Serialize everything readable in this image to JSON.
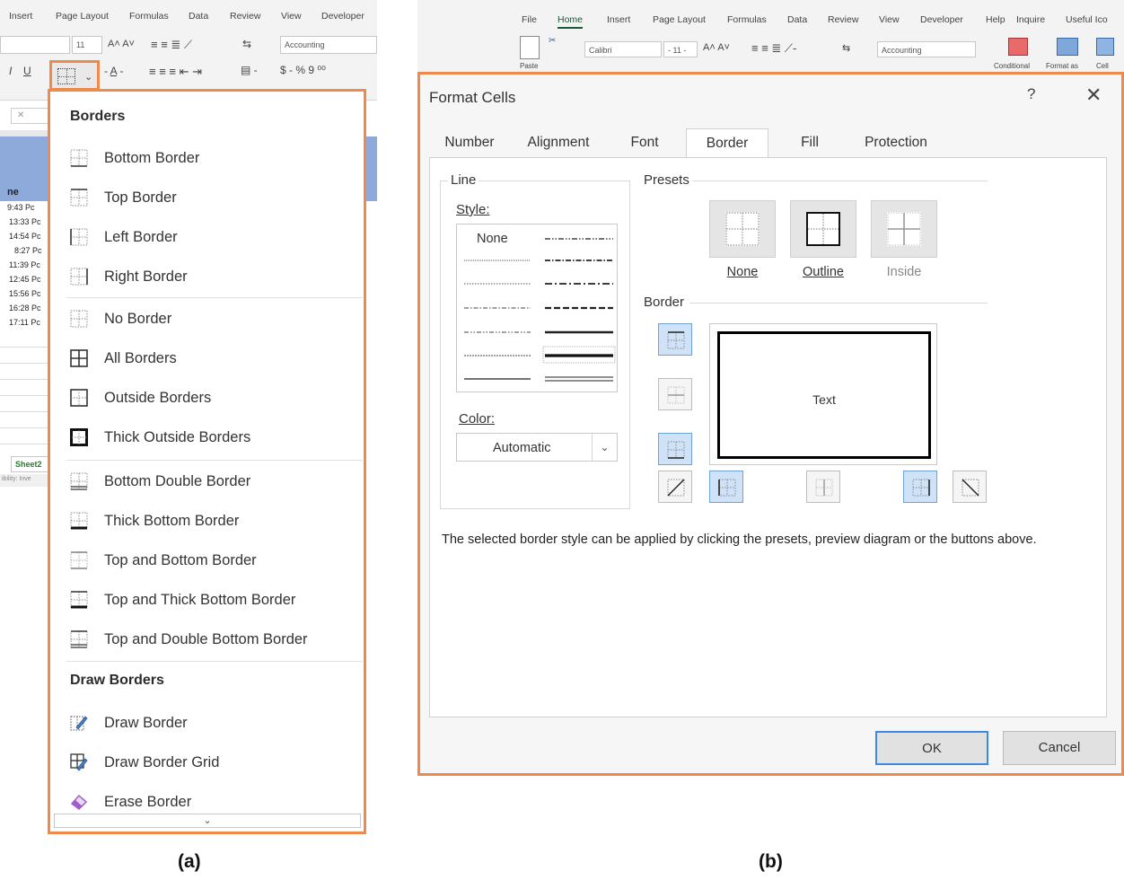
{
  "panel_a": {
    "ribbon": {
      "tabs": [
        "Insert",
        "Page Layout",
        "Formulas",
        "Data",
        "Review",
        "View",
        "Developer"
      ],
      "font_size": "11",
      "number_format": "Accounting"
    },
    "sheet": {
      "times": [
        "9:43",
        "13:33",
        "14:54",
        "8:27",
        "11:39",
        "12:45",
        "15:56",
        "16:28",
        "17:11"
      ],
      "suffix": "Pc",
      "col_header": "ne",
      "tab_name": "Sheet2",
      "status": "ibility: Inve"
    },
    "menu": {
      "section1": "Borders",
      "section2": "Draw Borders",
      "items": [
        {
          "label": "Bottom Border",
          "icon": "bottom-border-icon"
        },
        {
          "label": "Top Border",
          "icon": "top-border-icon"
        },
        {
          "label": "Left Border",
          "icon": "left-border-icon"
        },
        {
          "label": "Right Border",
          "icon": "right-border-icon"
        },
        {
          "label": "No Border",
          "icon": "no-border-icon"
        },
        {
          "label": "All Borders",
          "icon": "all-borders-icon"
        },
        {
          "label": "Outside Borders",
          "icon": "outside-borders-icon"
        },
        {
          "label": "Thick Outside Borders",
          "icon": "thick-outside-borders-icon"
        },
        {
          "label": "Bottom Double Border",
          "icon": "bottom-double-border-icon"
        },
        {
          "label": "Thick Bottom Border",
          "icon": "thick-bottom-border-icon"
        },
        {
          "label": "Top and Bottom Border",
          "icon": "top-bottom-border-icon"
        },
        {
          "label": "Top and Thick Bottom Border",
          "icon": "top-thick-bottom-border-icon"
        },
        {
          "label": "Top and Double Bottom Border",
          "icon": "top-double-bottom-border-icon"
        }
      ],
      "draw_items": [
        {
          "label": "Draw Border",
          "icon": "draw-border-icon"
        },
        {
          "label": "Draw Border Grid",
          "icon": "draw-border-grid-icon"
        },
        {
          "label": "Erase Border",
          "icon": "eraser-icon"
        }
      ]
    }
  },
  "panel_b": {
    "ribbon": {
      "tabs": [
        "File",
        "Home",
        "Insert",
        "Page Layout",
        "Formulas",
        "Data",
        "Review",
        "View",
        "Developer",
        "Help",
        "Inquire",
        "Useful Ico"
      ],
      "font": "Calibri",
      "font_size": "11",
      "number_format": "Accounting",
      "paste": "Paste",
      "conditional": "Conditional",
      "format_as": "Format as",
      "cell": "Cell"
    },
    "dialog": {
      "title": "Format Cells",
      "help": "?",
      "close": "✕",
      "tabs": [
        "Number",
        "Alignment",
        "Font",
        "Border",
        "Fill",
        "Protection"
      ],
      "active_tab": "Border",
      "line_group": "Line",
      "style_label": "Style:",
      "style_none": "None",
      "color_label": "Color:",
      "color_value": "Automatic",
      "presets_label": "Presets",
      "presets": [
        "None",
        "Outline",
        "Inside"
      ],
      "border_label": "Border",
      "preview_text": "Text",
      "hint": "The selected border style can be applied by clicking the presets, preview diagram or the buttons above.",
      "ok": "OK",
      "cancel": "Cancel"
    }
  },
  "captions": {
    "a": "(a)",
    "b": "(b)"
  },
  "colors": {
    "highlight": "#ef8a4f",
    "selected_button": "#cfe2f7",
    "sheet_header": "#8eaadb"
  }
}
